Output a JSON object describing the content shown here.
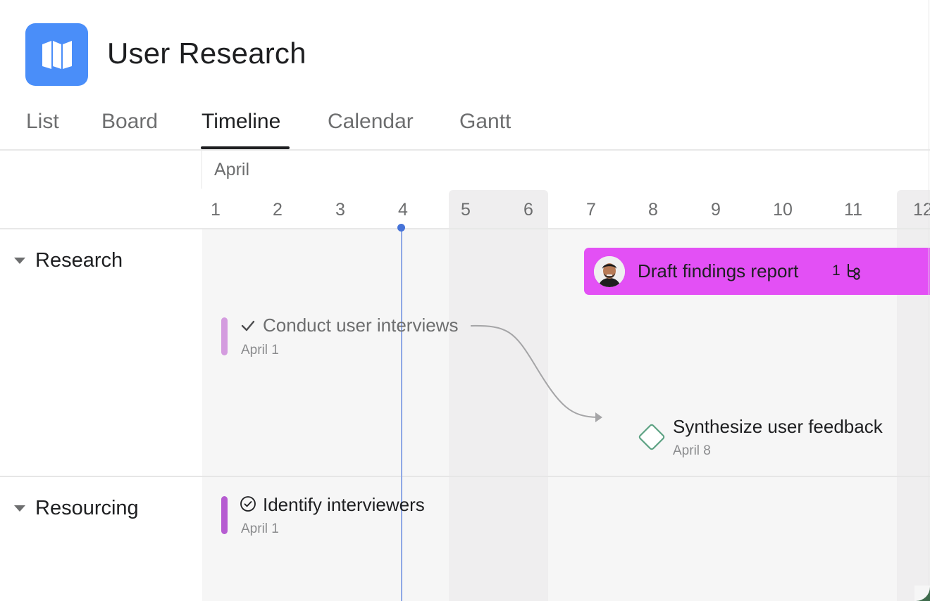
{
  "project": {
    "title": "User Research",
    "icon": "map-icon",
    "color": "#4a8ef9"
  },
  "tabs": [
    {
      "label": "List",
      "active": false
    },
    {
      "label": "Board",
      "active": false
    },
    {
      "label": "Timeline",
      "active": true
    },
    {
      "label": "Calendar",
      "active": false
    },
    {
      "label": "Gantt",
      "active": false
    }
  ],
  "timeline": {
    "month": "April",
    "days": [
      "1",
      "2",
      "3",
      "4",
      "5",
      "6",
      "7",
      "8",
      "9",
      "10",
      "11",
      "12"
    ],
    "today": "4"
  },
  "sections": [
    {
      "label": "Research"
    },
    {
      "label": "Resourcing"
    }
  ],
  "tasks": {
    "draft": {
      "title": "Draft findings report",
      "subtask_count": "1",
      "color": "#e350f5",
      "icon": "subtask-icon"
    },
    "conduct": {
      "title": "Conduct user interviews",
      "date": "April 1",
      "status_icon": "check-icon",
      "accent": "#d49cdf"
    },
    "synthesize": {
      "title": "Synthesize user feedback",
      "date": "April 8",
      "status_icon": "milestone-diamond-icon",
      "accent": "#5da283"
    },
    "identify": {
      "title": "Identify interviewers",
      "date": "April 1",
      "status_icon": "check-circle-icon",
      "accent": "#b65cd1"
    }
  }
}
